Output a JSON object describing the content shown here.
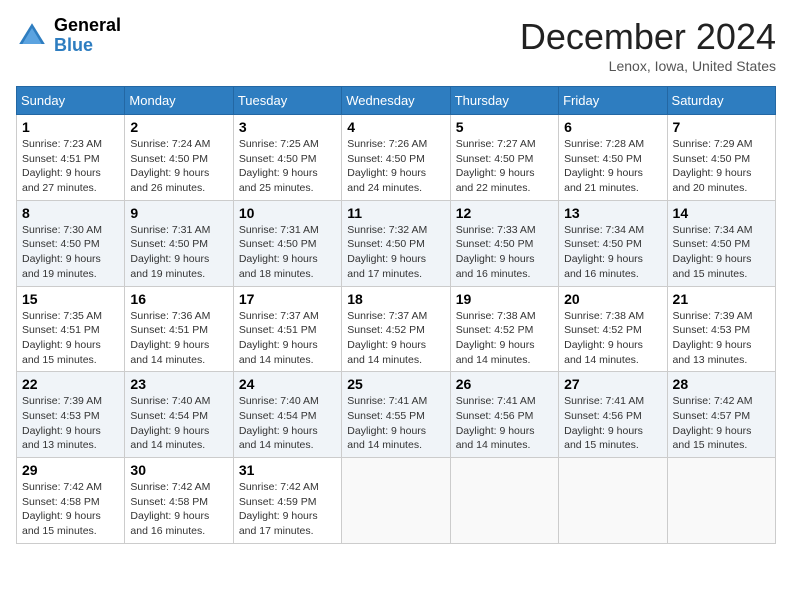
{
  "header": {
    "logo_general": "General",
    "logo_blue": "Blue",
    "title": "December 2024",
    "location": "Lenox, Iowa, United States"
  },
  "calendar": {
    "weekdays": [
      "Sunday",
      "Monday",
      "Tuesday",
      "Wednesday",
      "Thursday",
      "Friday",
      "Saturday"
    ],
    "weeks": [
      [
        {
          "day": "1",
          "sunrise": "7:23 AM",
          "sunset": "4:51 PM",
          "daylight": "9 hours and 27 minutes."
        },
        {
          "day": "2",
          "sunrise": "7:24 AM",
          "sunset": "4:50 PM",
          "daylight": "9 hours and 26 minutes."
        },
        {
          "day": "3",
          "sunrise": "7:25 AM",
          "sunset": "4:50 PM",
          "daylight": "9 hours and 25 minutes."
        },
        {
          "day": "4",
          "sunrise": "7:26 AM",
          "sunset": "4:50 PM",
          "daylight": "9 hours and 24 minutes."
        },
        {
          "day": "5",
          "sunrise": "7:27 AM",
          "sunset": "4:50 PM",
          "daylight": "9 hours and 22 minutes."
        },
        {
          "day": "6",
          "sunrise": "7:28 AM",
          "sunset": "4:50 PM",
          "daylight": "9 hours and 21 minutes."
        },
        {
          "day": "7",
          "sunrise": "7:29 AM",
          "sunset": "4:50 PM",
          "daylight": "9 hours and 20 minutes."
        }
      ],
      [
        {
          "day": "8",
          "sunrise": "7:30 AM",
          "sunset": "4:50 PM",
          "daylight": "9 hours and 19 minutes."
        },
        {
          "day": "9",
          "sunrise": "7:31 AM",
          "sunset": "4:50 PM",
          "daylight": "9 hours and 19 minutes."
        },
        {
          "day": "10",
          "sunrise": "7:31 AM",
          "sunset": "4:50 PM",
          "daylight": "9 hours and 18 minutes."
        },
        {
          "day": "11",
          "sunrise": "7:32 AM",
          "sunset": "4:50 PM",
          "daylight": "9 hours and 17 minutes."
        },
        {
          "day": "12",
          "sunrise": "7:33 AM",
          "sunset": "4:50 PM",
          "daylight": "9 hours and 16 minutes."
        },
        {
          "day": "13",
          "sunrise": "7:34 AM",
          "sunset": "4:50 PM",
          "daylight": "9 hours and 16 minutes."
        },
        {
          "day": "14",
          "sunrise": "7:34 AM",
          "sunset": "4:50 PM",
          "daylight": "9 hours and 15 minutes."
        }
      ],
      [
        {
          "day": "15",
          "sunrise": "7:35 AM",
          "sunset": "4:51 PM",
          "daylight": "9 hours and 15 minutes."
        },
        {
          "day": "16",
          "sunrise": "7:36 AM",
          "sunset": "4:51 PM",
          "daylight": "9 hours and 14 minutes."
        },
        {
          "day": "17",
          "sunrise": "7:37 AM",
          "sunset": "4:51 PM",
          "daylight": "9 hours and 14 minutes."
        },
        {
          "day": "18",
          "sunrise": "7:37 AM",
          "sunset": "4:52 PM",
          "daylight": "9 hours and 14 minutes."
        },
        {
          "day": "19",
          "sunrise": "7:38 AM",
          "sunset": "4:52 PM",
          "daylight": "9 hours and 14 minutes."
        },
        {
          "day": "20",
          "sunrise": "7:38 AM",
          "sunset": "4:52 PM",
          "daylight": "9 hours and 14 minutes."
        },
        {
          "day": "21",
          "sunrise": "7:39 AM",
          "sunset": "4:53 PM",
          "daylight": "9 hours and 13 minutes."
        }
      ],
      [
        {
          "day": "22",
          "sunrise": "7:39 AM",
          "sunset": "4:53 PM",
          "daylight": "9 hours and 13 minutes."
        },
        {
          "day": "23",
          "sunrise": "7:40 AM",
          "sunset": "4:54 PM",
          "daylight": "9 hours and 14 minutes."
        },
        {
          "day": "24",
          "sunrise": "7:40 AM",
          "sunset": "4:54 PM",
          "daylight": "9 hours and 14 minutes."
        },
        {
          "day": "25",
          "sunrise": "7:41 AM",
          "sunset": "4:55 PM",
          "daylight": "9 hours and 14 minutes."
        },
        {
          "day": "26",
          "sunrise": "7:41 AM",
          "sunset": "4:56 PM",
          "daylight": "9 hours and 14 minutes."
        },
        {
          "day": "27",
          "sunrise": "7:41 AM",
          "sunset": "4:56 PM",
          "daylight": "9 hours and 15 minutes."
        },
        {
          "day": "28",
          "sunrise": "7:42 AM",
          "sunset": "4:57 PM",
          "daylight": "9 hours and 15 minutes."
        }
      ],
      [
        {
          "day": "29",
          "sunrise": "7:42 AM",
          "sunset": "4:58 PM",
          "daylight": "9 hours and 15 minutes."
        },
        {
          "day": "30",
          "sunrise": "7:42 AM",
          "sunset": "4:58 PM",
          "daylight": "9 hours and 16 minutes."
        },
        {
          "day": "31",
          "sunrise": "7:42 AM",
          "sunset": "4:59 PM",
          "daylight": "9 hours and 17 minutes."
        },
        null,
        null,
        null,
        null
      ]
    ]
  }
}
